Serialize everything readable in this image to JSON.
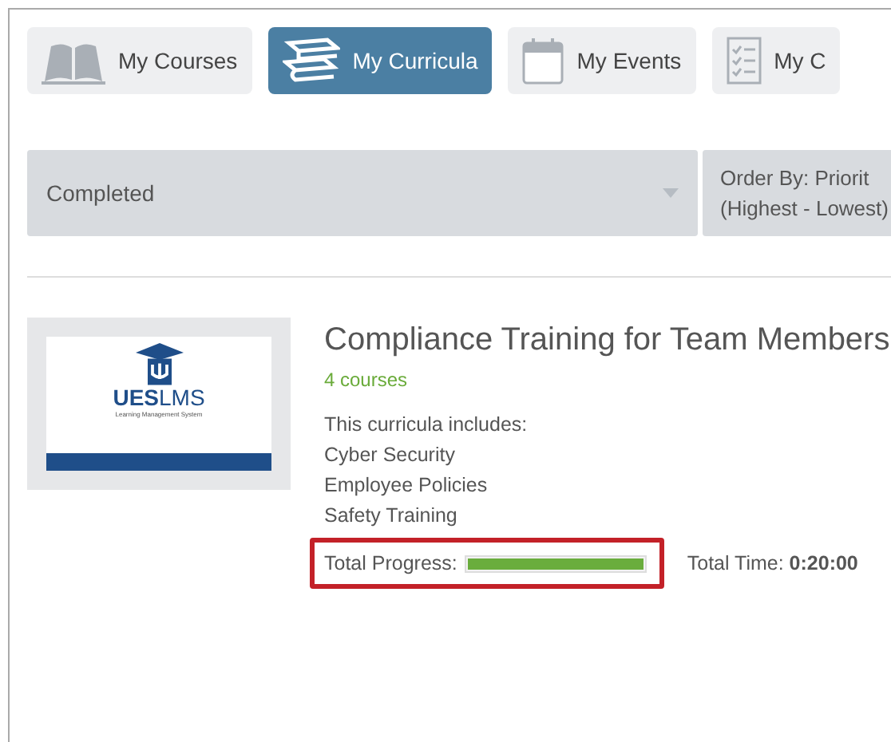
{
  "tabs": [
    {
      "label": "My Courses",
      "kind": "book",
      "selected": false
    },
    {
      "label": "My Curricula",
      "kind": "books",
      "selected": true
    },
    {
      "label": "My Events",
      "kind": "calendar",
      "selected": false
    },
    {
      "label": "My C",
      "kind": "checklist",
      "selected": false
    }
  ],
  "filters": {
    "status": "Completed",
    "order_by": [
      "Order By: Priorit",
      "(Highest - Lowest)"
    ]
  },
  "curricula": [
    {
      "logo": {
        "bold": "UES",
        "regular": "LMS",
        "tagline": "Learning Management System"
      },
      "title": "Compliance Training for Team Members",
      "course_count": "4 courses",
      "includes_label": "This curricula includes:",
      "courses": [
        "Cyber Security",
        "Employee Policies",
        "Safety Training"
      ],
      "progress_label": "Total Progress:",
      "level": 1,
      "highlighted": true,
      "time_label": "Total Time:",
      "time": "0:20:00"
    }
  ]
}
